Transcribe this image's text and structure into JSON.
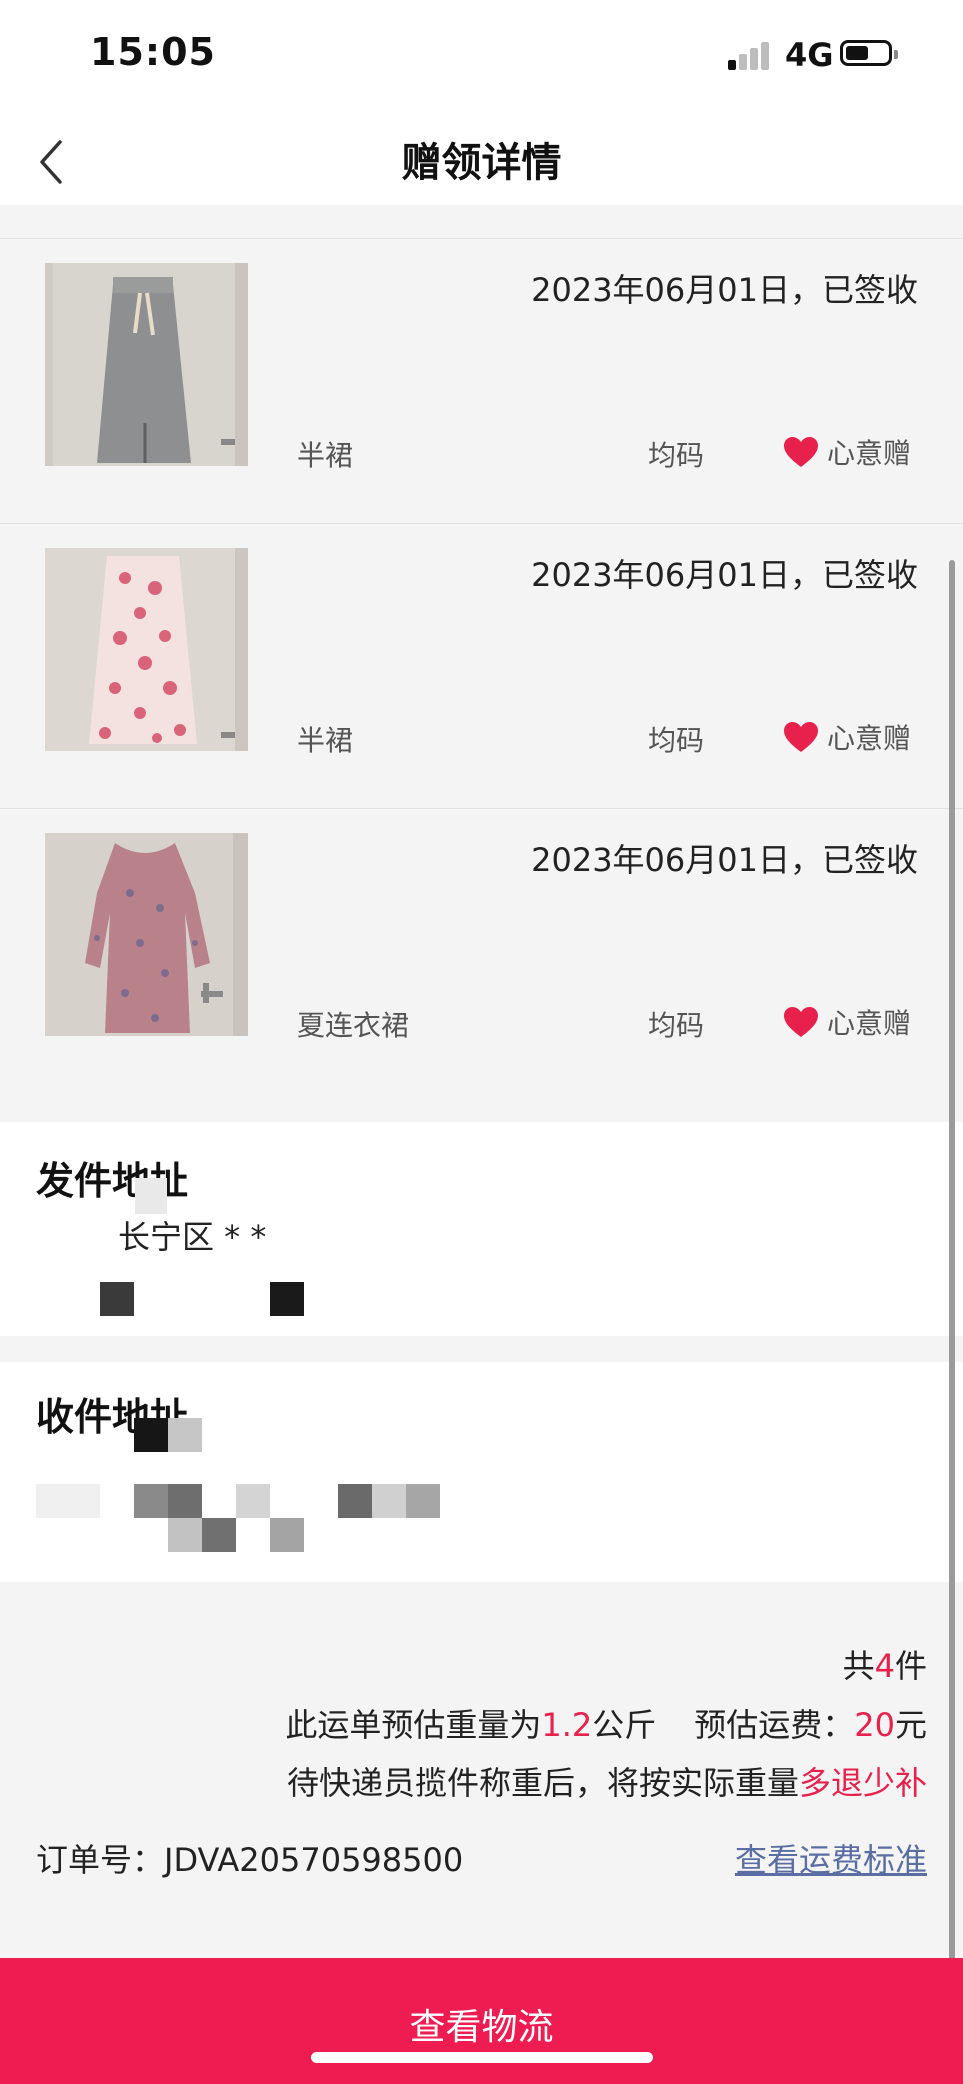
{
  "status_bar": {
    "time": "15:05",
    "network": "4G"
  },
  "nav": {
    "title": "赠领详情"
  },
  "items": [
    {
      "date": "2023年06月01日，已签收",
      "name": "半裙",
      "size": "均码",
      "gift": "心意赠"
    },
    {
      "date": "2023年06月01日，已签收",
      "name": "半裙",
      "size": "均码",
      "gift": "心意赠"
    },
    {
      "date": "2023年06月01日，已签收",
      "name": "夏连衣裙",
      "size": "均码",
      "gift": "心意赠"
    }
  ],
  "sender": {
    "title": "发件地址",
    "line1": "长宁区 *        *"
  },
  "receiver": {
    "title": "收件地址"
  },
  "summary": {
    "count_prefix": "共",
    "count": "4",
    "count_suffix": "件",
    "weight_prefix": "此运单预估重量为",
    "weight": "1.2",
    "weight_unit": "公斤",
    "fee_label": "预估运费：",
    "fee": "20",
    "fee_unit": "元",
    "note_prefix": "待快递员揽件称重后，将按实际重量",
    "note_highlight": "多退少补"
  },
  "order": {
    "label": "订单号：",
    "number": "JDVA20570598500",
    "fee_link": "查看运费标准"
  },
  "bottom_button": {
    "label": "查看物流"
  },
  "colors": {
    "accent": "#ee1c51",
    "highlight": "#e8204c",
    "link": "#5a6ea3"
  }
}
